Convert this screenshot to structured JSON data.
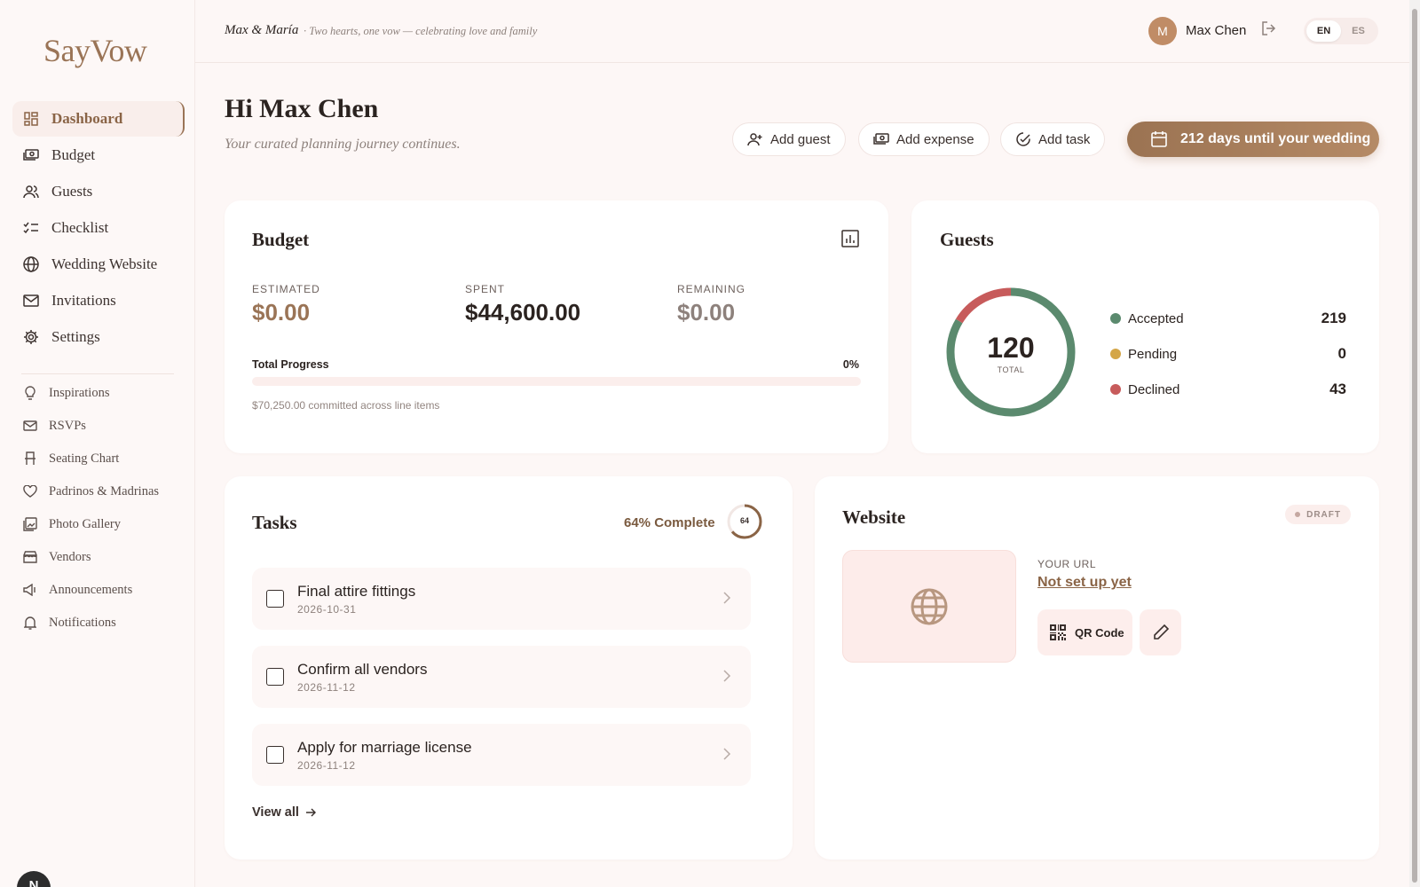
{
  "brand": {
    "logo": "SayVow"
  },
  "sidebar": {
    "primary": [
      {
        "label": "Dashboard",
        "icon": "dashboard-icon"
      },
      {
        "label": "Budget",
        "icon": "money-icon"
      },
      {
        "label": "Guests",
        "icon": "users-icon"
      },
      {
        "label": "Checklist",
        "icon": "checklist-icon"
      },
      {
        "label": "Wedding Website",
        "icon": "globe-icon"
      },
      {
        "label": "Invitations",
        "icon": "mail-icon"
      },
      {
        "label": "Settings",
        "icon": "gear-icon"
      }
    ],
    "secondary": [
      {
        "label": "Inspirations",
        "icon": "lightbulb-icon"
      },
      {
        "label": "RSVPs",
        "icon": "mail-icon"
      },
      {
        "label": "Seating Chart",
        "icon": "chair-icon"
      },
      {
        "label": "Padrinos & Madrinas",
        "icon": "heart-icon"
      },
      {
        "label": "Photo Gallery",
        "icon": "gallery-icon"
      },
      {
        "label": "Vendors",
        "icon": "store-icon"
      },
      {
        "label": "Announcements",
        "icon": "megaphone-icon"
      },
      {
        "label": "Notifications",
        "icon": "bell-icon"
      }
    ],
    "badge": "N"
  },
  "topbar": {
    "couple": "Max & María",
    "tagline": "· Two hearts, one vow — celebrating love and family",
    "avatar_initial": "M",
    "user_name": "Max Chen",
    "languages": [
      "EN",
      "ES"
    ],
    "active_language": "EN"
  },
  "header": {
    "greeting": "Hi Max Chen",
    "subtitle": "Your curated planning journey continues.",
    "actions": {
      "add_guest": "Add guest",
      "add_expense": "Add expense",
      "add_task": "Add task"
    },
    "countdown": "212 days until your wedding"
  },
  "budget": {
    "title": "Budget",
    "estimated_label": "ESTIMATED",
    "estimated_value": "$0.00",
    "spent_label": "SPENT",
    "spent_value": "$44,600.00",
    "remaining_label": "REMAINING",
    "remaining_value": "$0.00",
    "progress_label": "Total Progress",
    "progress_pct_text": "0%",
    "progress_fraction": 0,
    "committed": "$70,250.00 committed across line items"
  },
  "guests": {
    "title": "Guests",
    "total": "120",
    "total_label": "TOTAL",
    "legend": [
      {
        "name": "Accepted",
        "value": "219",
        "color": "#5b8a6e"
      },
      {
        "name": "Pending",
        "value": "0",
        "color": "#d4a648"
      },
      {
        "name": "Declined",
        "value": "43",
        "color": "#c75b5b"
      }
    ]
  },
  "tasks": {
    "title": "Tasks",
    "complete_text": "64% Complete",
    "complete_pct": 64,
    "ring_label": "64",
    "items": [
      {
        "name": "Final attire fittings",
        "date": "2026-10-31"
      },
      {
        "name": "Confirm all vendors",
        "date": "2026-11-12"
      },
      {
        "name": "Apply for marriage license",
        "date": "2026-11-12"
      }
    ],
    "view_all": "View all"
  },
  "website": {
    "title": "Website",
    "status": "DRAFT",
    "url_label": "YOUR URL",
    "url_value": "Not set up yet",
    "qr_label": "QR Code"
  }
}
